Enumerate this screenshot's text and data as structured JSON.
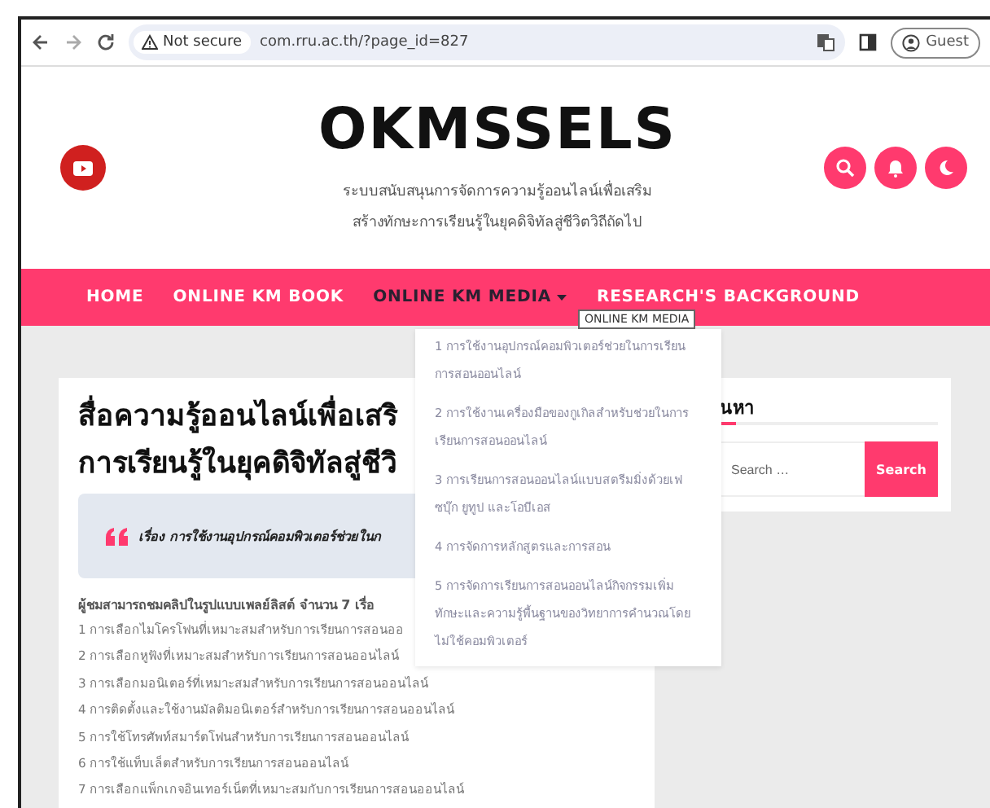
{
  "browser": {
    "security": "Not secure",
    "url": "com.rru.ac.th/?page_id=827",
    "profile": "Guest"
  },
  "header": {
    "logo": "OKMSSELS",
    "tagline": [
      "ระบบสนับสนุนการจัดการความรู้ออนไลน์เพื่อเสริม",
      "สร้างทักษะการเรียนรู้ในยุคดิจิทัลสู่ชีวิตวิถีถัดไป"
    ]
  },
  "nav": [
    {
      "label": "HOME",
      "selected": false,
      "has_menu": false
    },
    {
      "label": "ONLINE KM BOOK",
      "selected": false,
      "has_menu": false
    },
    {
      "label": "ONLINE KM MEDIA",
      "selected": true,
      "has_menu": true
    },
    {
      "label": "RESEARCH'S BACKGROUND",
      "selected": false,
      "has_menu": false
    }
  ],
  "tooltip": "ONLINE KM MEDIA",
  "dropdown": [
    "1 การใช้งานอุปกรณ์คอมพิวเตอร์ช่วยในการเรียนการสอนออนไลน์",
    "2 การใช้งานเครื่องมือของกูเกิลสำหรับช่วยในการเรียนการสอนออนไลน์",
    "3 การเรียนการสอนออนไลน์แบบสตรีมมิ่งด้วยเฟซบุ๊ก ยูทูป และโอบีเอส",
    "4 การจัดการหลักสูตรและการสอน",
    "5 การจัดการเรียนการสอนออนไลน์กิจกรรมเพิ่มทักษะและความรู้พื้นฐานของวิทยาการคำนวณโดยไม่ใช้คอมพิวเตอร์"
  ],
  "article": {
    "title": [
      "สื่อความรู้ออนไลน์เพื่อเสริ",
      "การเรียนรู้ในยุคดิจิทัลสู่ชีวิ"
    ],
    "quote": "เรื่อง การใช้งานอุปกรณ์คอมพิวเตอร์ช่วยในก",
    "list_heading": "ผู้ชมสามารถชมคลิปในรูปแบบเพลย์ลิสต์ จำนวน 7 เรื่อ",
    "items": [
      "1 การเลือกไมโครโฟนที่เหมาะสมสำหรับการเรียนการสอนออ",
      "2 การเลือกหูฟังที่เหมาะสมสำหรับการเรียนการสอนออนไลน์",
      "3 การเลือกมอนิเตอร์ที่เหมาะสมสำหรับการเรียนการสอนออนไลน์",
      "4 การติดตั้งและใช้งานมัลติมอนิเตอร์สำหรับการเรียนการสอนออนไลน์",
      "5 การใช้โทรศัพท์สมาร์ตโฟนสำหรับการเรียนการสอนออนไลน์",
      "6 การใช้แท็บเล็ตสำหรับการเรียนการสอนออนไลน์",
      "7 การเลือกแพ็กเกจอินเทอร์เน็ตที่เหมาะสมกับการเรียนการสอนออนไลน์"
    ]
  },
  "widget": {
    "title": "นหา",
    "placeholder": "Search …",
    "button": "Search"
  }
}
